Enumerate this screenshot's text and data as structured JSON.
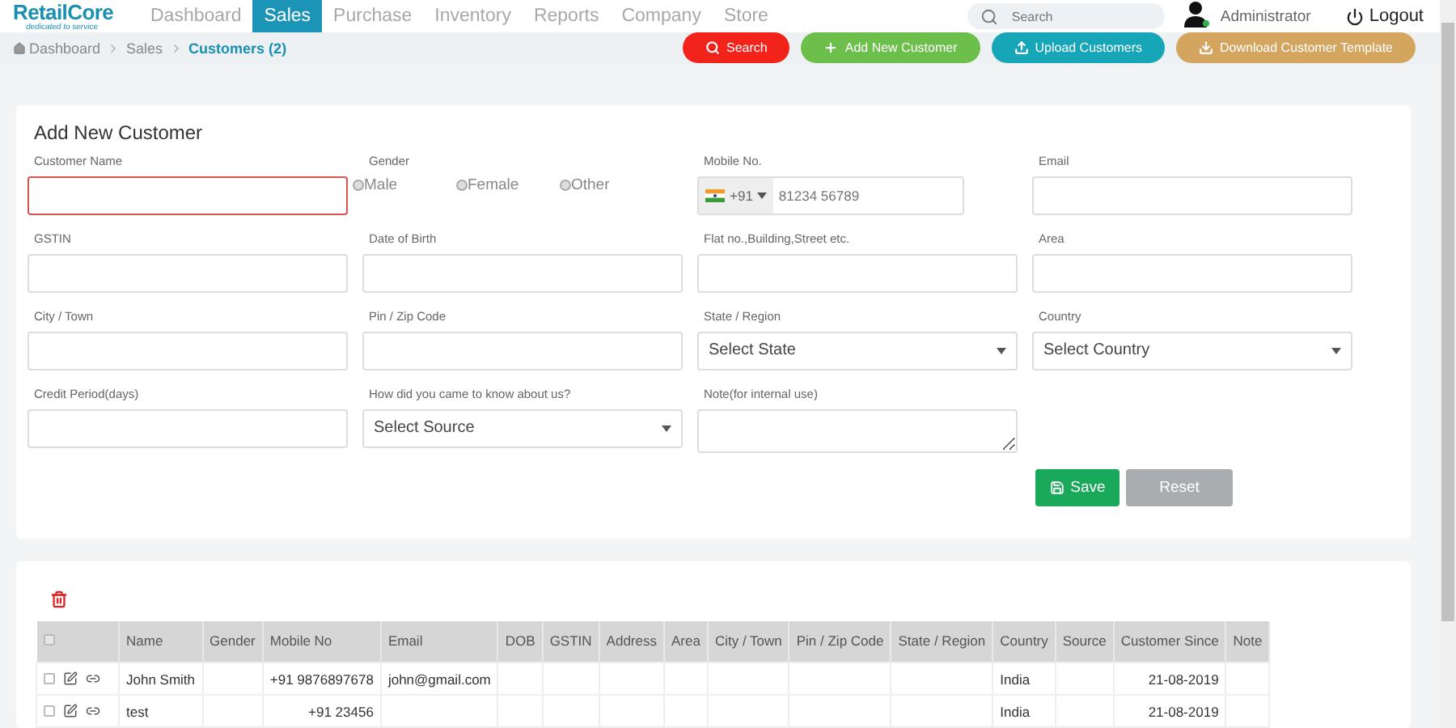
{
  "brand": {
    "name": "RetailCore",
    "tagline": "dedicated to service"
  },
  "nav": [
    {
      "label": "Dashboard",
      "selected": false
    },
    {
      "label": "Sales",
      "selected": true
    },
    {
      "label": "Purchase",
      "selected": false
    },
    {
      "label": "Inventory",
      "selected": false
    },
    {
      "label": "Reports",
      "selected": false
    },
    {
      "label": "Company",
      "selected": false
    },
    {
      "label": "Store",
      "selected": false
    }
  ],
  "search": {
    "placeholder": "Search"
  },
  "user": {
    "name": "Administrator"
  },
  "logout": "Logout",
  "breadcrumb": [
    "Dashboard",
    "Sales",
    "Customers (2)"
  ],
  "actions": [
    {
      "label": "Search",
      "kind": "search",
      "color": "#f2231b"
    },
    {
      "label": "Add New Customer",
      "kind": "add",
      "color": "#6dbf4b"
    },
    {
      "label": "Upload Customers",
      "kind": "upload",
      "color": "#17a5b8"
    },
    {
      "label": "Download Customer Template",
      "kind": "download",
      "color": "#d4a55e"
    }
  ],
  "form": {
    "title": "Add New Customer",
    "fields": [
      {
        "label": "Customer Name",
        "kind": "text",
        "invalid": true
      },
      {
        "label": "Gender",
        "kind": "radio",
        "options": [
          {
            "label": "Male",
            "selected": false
          },
          {
            "label": "Female",
            "selected": false
          },
          {
            "label": "Other",
            "selected": false
          }
        ]
      },
      {
        "label": "Mobile No.",
        "kind": "phone",
        "code": "+91",
        "placeholder": "81234 56789"
      },
      {
        "label": "Email",
        "kind": "text",
        "invalid": false
      },
      {
        "label": "GSTIN",
        "kind": "text",
        "invalid": false
      },
      {
        "label": "Date of Birth",
        "kind": "text",
        "invalid": false
      },
      {
        "label": "Flat no.,Building,Street etc.",
        "kind": "text",
        "invalid": false
      },
      {
        "label": "Area",
        "kind": "text",
        "invalid": false
      },
      {
        "label": "City / Town",
        "kind": "text",
        "invalid": false
      },
      {
        "label": "Pin / Zip Code",
        "kind": "text",
        "invalid": false
      },
      {
        "label": "State / Region",
        "kind": "select",
        "value": "Select State"
      },
      {
        "label": "Country",
        "kind": "select",
        "value": "Select Country"
      },
      {
        "label": "Credit Period(days)",
        "kind": "text",
        "invalid": false
      },
      {
        "label": "How did you came to know about us?",
        "kind": "select",
        "value": "Select Source"
      },
      {
        "label": "Note(for internal use)",
        "kind": "textarea"
      }
    ],
    "buttons": [
      {
        "label": "Save",
        "kind": "save",
        "disabled": false
      },
      {
        "label": "Reset",
        "kind": "reset",
        "disabled": true
      }
    ]
  },
  "table": {
    "all_checked": false,
    "columns": [
      "Name",
      "Gender",
      "Mobile No",
      "Email",
      "DOB",
      "GSTIN",
      "Address",
      "Area",
      "City / Town",
      "Pin / Zip Code",
      "State / Region",
      "Country",
      "Source",
      "Customer Since",
      "Note"
    ],
    "rows": [
      {
        "checked": false,
        "cells": [
          "John Smith",
          null,
          "+91 9876897678",
          "john@gmail.com",
          null,
          null,
          null,
          null,
          null,
          null,
          null,
          "India",
          null,
          "21-08-2019",
          null
        ]
      },
      {
        "checked": false,
        "cells": [
          "test",
          null,
          "+91 23456",
          null,
          null,
          null,
          null,
          null,
          null,
          null,
          null,
          "India",
          null,
          "21-08-2019",
          null
        ]
      }
    ]
  }
}
